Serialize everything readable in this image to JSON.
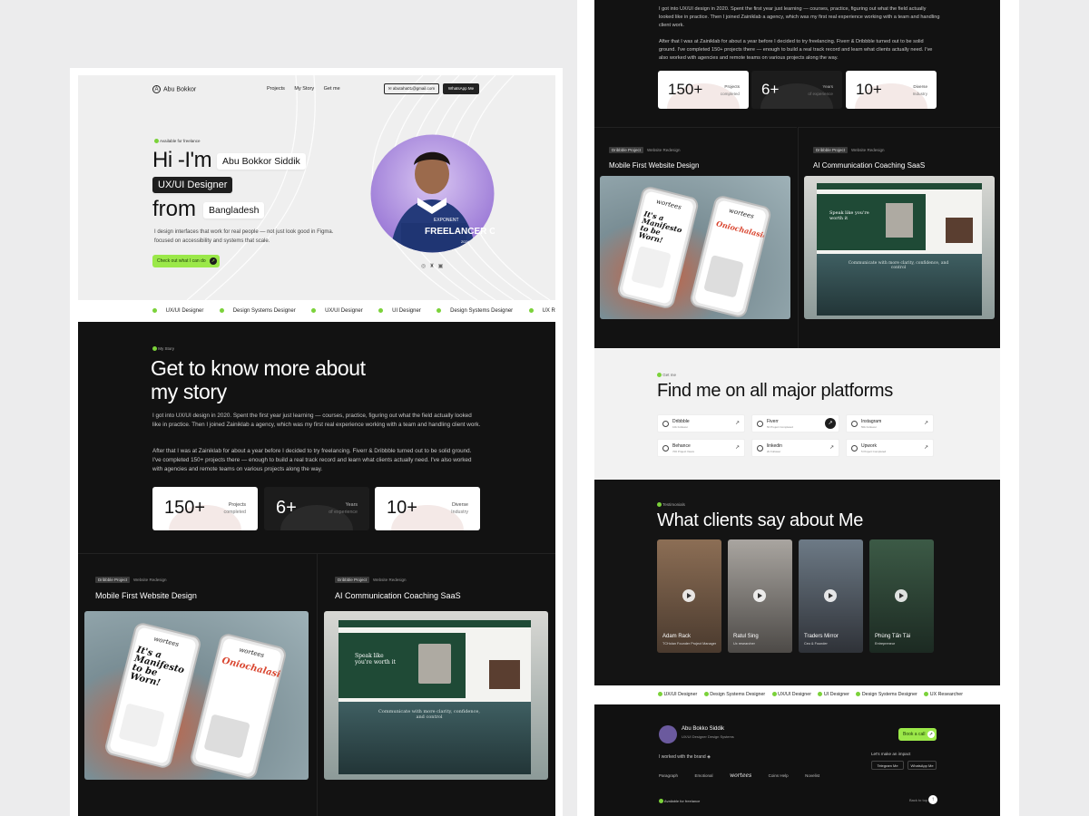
{
  "nav": {
    "logo": "Abu Bokkor",
    "links": [
      "Projects",
      "My Story",
      "Get me"
    ],
    "email": "abutaha01@gmail.com",
    "whatsapp": "WhatsApp Me"
  },
  "hero": {
    "availability": "Available for freelance",
    "greeting": "Hi -I'm",
    "name": "Abu Bokkor Siddik",
    "role": "UX/UI Designer",
    "from_word": "from",
    "country": "Bangladesh",
    "description": "I design interfaces that work for real people — not just look good in Figma. focused on accessibility and systems that scale.",
    "cta": "Check out what I can do",
    "portrait_event": "FREELANCER CONNECT",
    "portrait_event_prefix": "EXPONENT",
    "portrait_event_year": "2024"
  },
  "ticker": [
    "UX/UI Designer",
    "Design Systems Designer",
    "UX/UI Designer",
    "UI Designer",
    "Design Systems Designer",
    "UX Researcher"
  ],
  "story": {
    "tag": "My Story",
    "title_line1": "Get to know more about",
    "title_line2": "my story",
    "para1": "I got into UX/UI design in 2020. Spent the first year just learning — courses, practice, figuring out what the field actually looked like in practice. Then I joined Zainiklab a agency, which was my first real experience working with a team and handling client work.",
    "para2": "After that I was at Zainiklab for about a year before I decided to try freelancing. Fiverr & Dribbble turned out to be solid ground. I've completed 150+ projects there — enough to build a real track record and learn what clients actually need. I've also worked with agencies and remote teams on various projects along the way.",
    "para1_right": "I got into UX/UI design in 2020. Spent the first year just learning — courses, practice, figuring out what the field actually looked like in practice. Then I joined Zainiklab a agency, which was my first real experience working with a team and handling client work."
  },
  "stats": [
    {
      "num": "150+",
      "l1": "Projects",
      "l2": "completed"
    },
    {
      "num": "6+",
      "l1": "Years",
      "l2": "of experience"
    },
    {
      "num": "10+",
      "l1": "Diverse",
      "l2": "Industry"
    }
  ],
  "projects": [
    {
      "badge": "Dribbble Project",
      "type": "Website Redesign",
      "title": "Mobile First Website Design"
    },
    {
      "badge": "Dribbble Project",
      "type": "Website Redesign",
      "title": "AI Communication Coaching SaaS"
    }
  ],
  "mockups": {
    "brand": "wortees",
    "headline_a": "It's a Manifesto to be Worn!",
    "headline_b": "Oniochalasia",
    "saas_hero": "Speak like you're worth it",
    "saas_sub": "Communicate with more clarity, confidence, and control"
  },
  "platforms": {
    "tag": "Get me",
    "title": "Find me on all major platforms",
    "items": [
      {
        "name": "Dribbble",
        "sub": "10k Follower"
      },
      {
        "name": "Fiverr",
        "sub": "50 Project Completed"
      },
      {
        "name": "Instagram",
        "sub": "50k Follower"
      },
      {
        "name": "Behance",
        "sub": "700 Project Views"
      },
      {
        "name": "linkedin",
        "sub": "2k Follower"
      },
      {
        "name": "Upwork",
        "sub": "5 Project Completed"
      }
    ]
  },
  "testimonials": {
    "tag": "Testimonials",
    "title": "What clients say about Me",
    "items": [
      {
        "name": "Adam Rack",
        "role": "TCHolan Founder Project Manager"
      },
      {
        "name": "Ratul Sing",
        "role": "Ux researcher"
      },
      {
        "name": "Traders Mirror",
        "role": "Ceo & Founder"
      },
      {
        "name": "Phùng Tấn Tài",
        "role": "Entrepreneur"
      }
    ]
  },
  "footer": {
    "name": "Abu Bokko Siddik",
    "subtitle": "UX/UI Designer Design Systems",
    "book": "Book a call",
    "worked": "I worked with the brand",
    "brands": [
      "Paragraph",
      "Emotional",
      "wortees",
      "Coins Help",
      "Novelist"
    ],
    "impact": "Let's make an impact",
    "telegram": "Telegram Me",
    "whatsapp": "WhatsApp Me",
    "available": "Available for freelance",
    "back_top": "Back to top"
  }
}
